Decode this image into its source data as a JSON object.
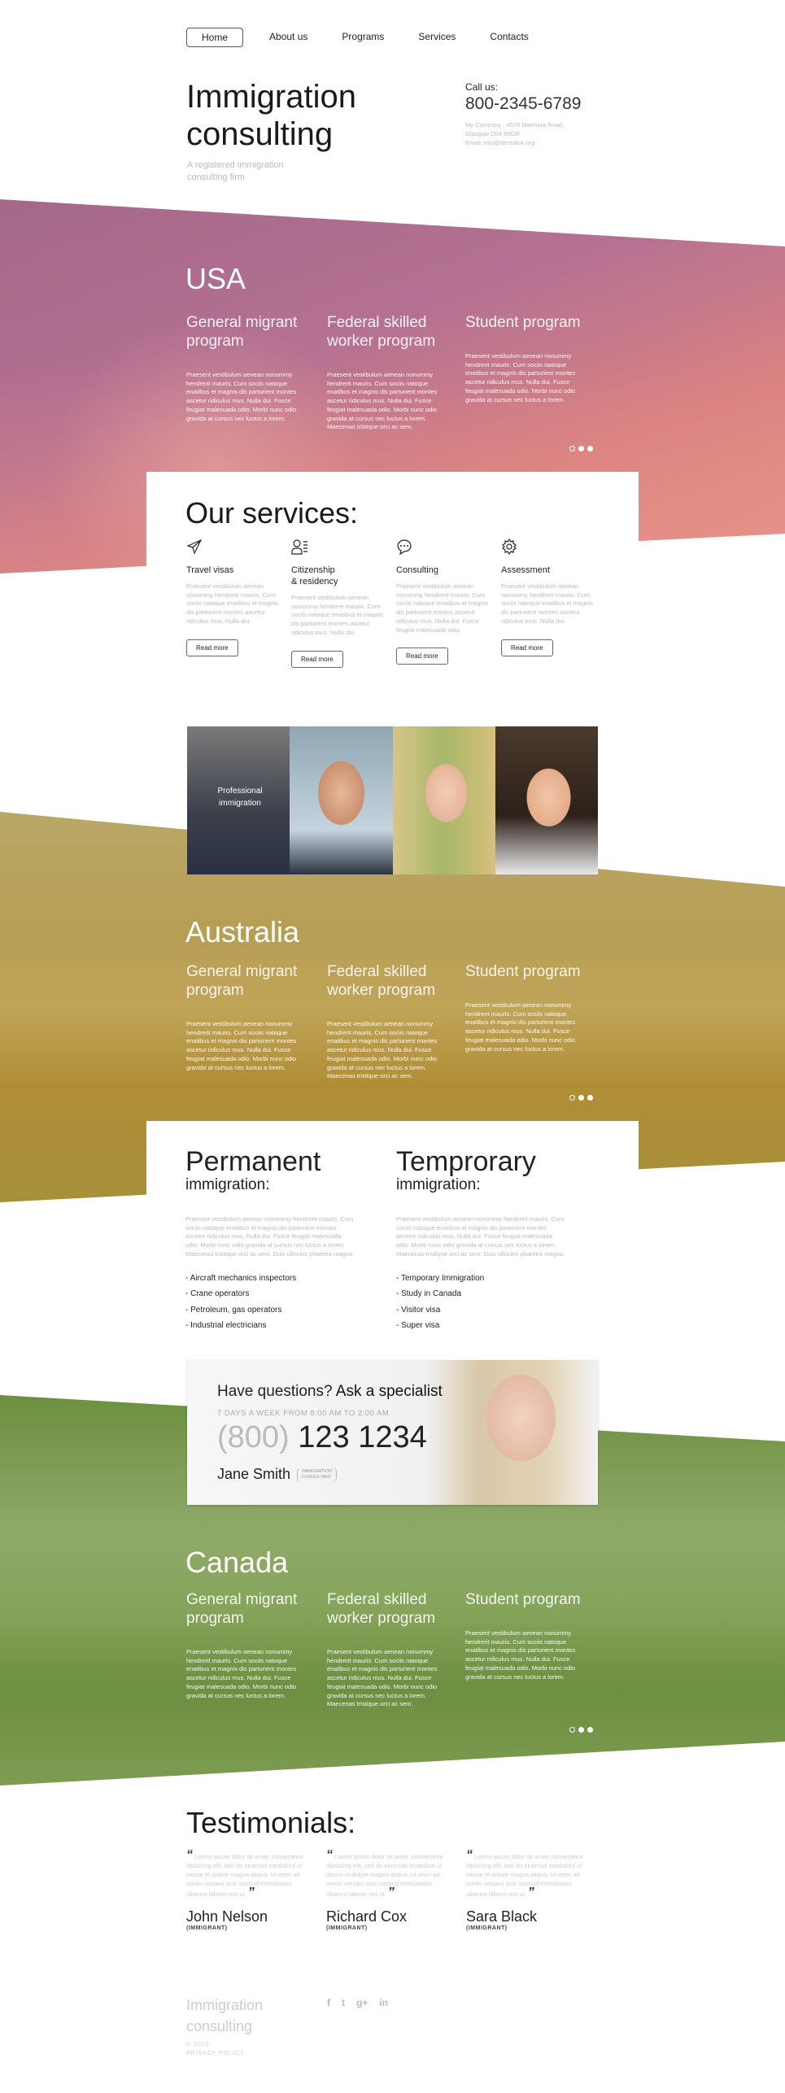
{
  "nav": [
    {
      "label": "Home",
      "active": true
    },
    {
      "label": "About us"
    },
    {
      "label": "Programs"
    },
    {
      "label": "Services"
    },
    {
      "label": "Contacts"
    }
  ],
  "header": {
    "title_line1": "Immigration",
    "title_line2": "consulting",
    "tagline_line1": "A registered immigration",
    "tagline_line2": "consulting firm",
    "call_label": "Call us:",
    "phone": "800-2345-6789",
    "address_line1": "My Company , 4578 Marmora Road,",
    "address_line2": "Glasgow D04 89GR",
    "email": "Email: info@demolink.org"
  },
  "programs_text": {
    "short": "Praesent vestibulum aenean nonummy hendrerit mauris. Cum sociis natoque enatibus et magnis dis parturient montes ascetur ridiculus mus. Nulla dui. Fusce feugiat malesuada odio. Morbi nunc odio gravida at cursus nec luctus a lorem.",
    "long": "Praesent vestibulum aenean nonummy hendrerit mauris. Cum sociis natoque enatibus et magnis dis parturient montes ascetur ridiculus mus. Nulla dui. Fusce feugiat malesuada odio. Morbi nunc odio gravida at cursus nec luctus a lorem. Maecenas tristique orci ac sem."
  },
  "countries": [
    {
      "name": "USA",
      "color": "#b56e8e",
      "programs": [
        "General migrant program",
        "Federal skilled worker program",
        "Student program"
      ]
    },
    {
      "name": "Australia",
      "color": "#b49a4c",
      "programs": [
        "General migrant program",
        "Federal skilled worker program",
        "Student program"
      ]
    },
    {
      "name": "Canada",
      "color": "#7d9c52",
      "programs": [
        "General migrant program",
        "Federal skilled worker program",
        "Student program"
      ]
    }
  ],
  "slider_dots": {
    "count": 3,
    "active": 1
  },
  "services": {
    "title": "Our services:",
    "read_more": "Read more",
    "items": [
      {
        "icon": "paper-plane-icon",
        "title": "Travel visas",
        "text": "Praesent vestibulum aenean nonummy hendrerit mauris. Cum sociis natoque enatibus et magnis dis parturient montes ascetur ridiculus mus. Nulla dui."
      },
      {
        "icon": "user-list-icon",
        "title": "Citizenship & residency",
        "text": "Praesent vestibulum aenean nonummy hendrerit mauris. Cum sociis natoque enatibus et magnis dis parturient montes ascetur ridiculus mus. Nulla dui."
      },
      {
        "icon": "chat-bubble-icon",
        "title": "Consulting",
        "text": "Praesent vestibulum aenean nonummy hendrerit mauris. Cum sociis natoque enatibus et magnis dis parturient montes ascetur ridiculus mus. Nulla dui. Fusce feugiat malesuada odio."
      },
      {
        "icon": "gear-icon",
        "title": "Assessment",
        "text": "Praesent vestibulum aenean nonummy hendrerit mauris. Cum sociis natoque enatibus et magnis dis parturient montes ascetur ridiculus mus. Nulla dui."
      }
    ]
  },
  "photos": {
    "overlay_label": "Professional immigration"
  },
  "immigration": {
    "text": "Praesent vestibulum aenean nonummy hendrerit mauris. Cum sociis natoque enatibus et magnis dis parturient montes ascetur ridiculus mus. Nulla dui. Fusce feugiat malesuada odio. Morbi nunc odio gravida at cursus nec luctus a lorem. Maecenas tristique orci ac sem. Duis ultricies pharetra magna.",
    "columns": [
      {
        "big": "Permanent",
        "small": "immigration:",
        "items": [
          "Aircraft mechanics inspectors",
          "Crane operators",
          "Petroleum, gas operators",
          "Industrial electricians"
        ]
      },
      {
        "big": "Temprorary",
        "small": "immigration:",
        "items": [
          "Temporary Immigration",
          "Study in Canada",
          "Visitor visa",
          "Super visa"
        ]
      }
    ]
  },
  "specialist": {
    "question": "Have questions?",
    "ask": "Ask a specialist",
    "hours": "7 DAYS A WEEK FROM 8:00 AM TO 2:00 AM",
    "area_code": "(800)",
    "number": "123 1234",
    "name": "Jane Smith",
    "role_line1": "IMMIGRATION",
    "role_line2": "CONSULTANT"
  },
  "testimonials": {
    "title": "Testimonials:",
    "text": "Lorem ipsum dolor sit amet, consectetur dipisicing elit, sed do eiusmod Incididunt ut labore et dolore magna aliqua. Ut enim ad minim veniam quis nostrud exercitation ullamco laboris nisi ut.",
    "open_quote": "“",
    "close_quote": "”",
    "items": [
      {
        "name": "John Nelson",
        "role": "(IMMIGRANT)"
      },
      {
        "name": "Richard Cox",
        "role": "(IMMIGRANT)"
      },
      {
        "name": "Sara Black",
        "role": "(IMMIGRANT)"
      }
    ]
  },
  "footer": {
    "line1": "Immigration",
    "line2": "consulting",
    "copyright": "© 2015",
    "privacy": "PRIVACY POLICY",
    "social": [
      {
        "icon": "facebook-icon",
        "glyph": "f"
      },
      {
        "icon": "twitter-icon",
        "glyph": "t"
      },
      {
        "icon": "google-plus-icon",
        "glyph": "g+"
      },
      {
        "icon": "linkedin-icon",
        "glyph": "in"
      }
    ]
  }
}
